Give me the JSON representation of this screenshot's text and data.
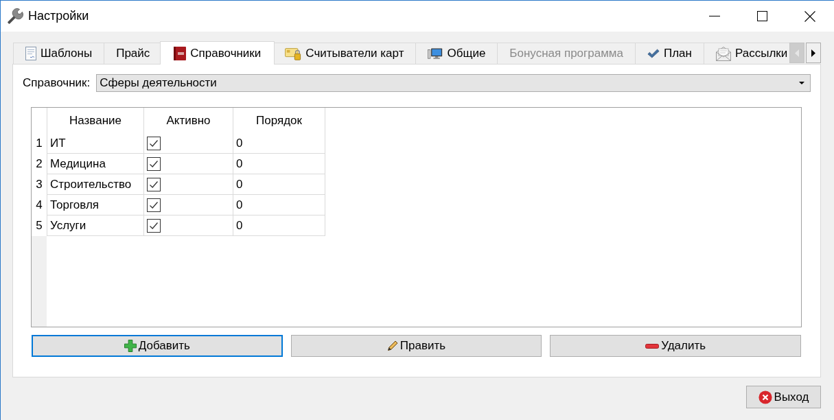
{
  "window": {
    "title": "Настройки"
  },
  "tabs": [
    {
      "label": "Шаблоны",
      "selected": false,
      "disabled": false
    },
    {
      "label": "Прайс",
      "selected": false,
      "disabled": false
    },
    {
      "label": "Справочники",
      "selected": true,
      "disabled": false
    },
    {
      "label": "Считыватели карт",
      "selected": false,
      "disabled": false
    },
    {
      "label": "Общие",
      "selected": false,
      "disabled": false
    },
    {
      "label": "Бонусная программа",
      "selected": false,
      "disabled": true
    },
    {
      "label": "План",
      "selected": false,
      "disabled": false
    },
    {
      "label": "Рассылки",
      "selected": false,
      "disabled": false
    }
  ],
  "tab_scroller": {
    "back_disabled": true,
    "forward_disabled": false
  },
  "directory": {
    "label": "Справочник:",
    "value": "Сферы деятельности"
  },
  "table": {
    "columns": [
      "Название",
      "Активно",
      "Порядок"
    ],
    "rows": [
      {
        "number": "1",
        "name": "ИТ",
        "active": true,
        "order": "0"
      },
      {
        "number": "2",
        "name": "Медицина",
        "active": true,
        "order": "0"
      },
      {
        "number": "3",
        "name": "Строительство",
        "active": true,
        "order": "0"
      },
      {
        "number": "4",
        "name": "Торговля",
        "active": true,
        "order": "0"
      },
      {
        "number": "5",
        "name": "Услуги",
        "active": true,
        "order": "0"
      }
    ]
  },
  "buttons": [
    {
      "label": "Добавить",
      "focused": true
    },
    {
      "label": "Править",
      "focused": false
    },
    {
      "label": "Удалить",
      "focused": false
    }
  ],
  "exit_button": {
    "label": "Выход"
  }
}
